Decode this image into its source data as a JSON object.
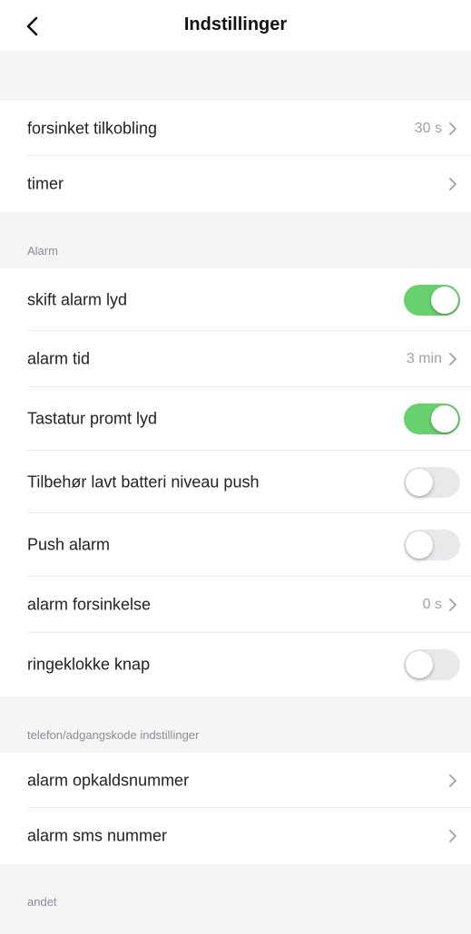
{
  "header": {
    "title": "Indstillinger",
    "back_icon": "chevron-left-icon"
  },
  "colors": {
    "toggle_on": "#67d16d",
    "toggle_off": "#e9e9eb",
    "section_bg": "#f5f5f5",
    "muted_text": "#a0a0a5"
  },
  "general": {
    "delay": {
      "label": "forsinket tilkobling",
      "value": "30 s"
    },
    "timer": {
      "label": "timer"
    }
  },
  "alarm": {
    "caption": "Alarm",
    "change_sound": {
      "label": "skift alarm lyd",
      "enabled": true
    },
    "alarm_time": {
      "label": "alarm tid",
      "value": "3 min"
    },
    "keypad_sound": {
      "label": "Tastatur promt lyd",
      "enabled": true
    },
    "low_battery_push": {
      "label": "Tilbehør lavt batteri niveau push",
      "enabled": false
    },
    "push_alarm": {
      "label": "Push alarm",
      "enabled": false
    },
    "alarm_delay": {
      "label": "alarm forsinkelse",
      "value": "0 s"
    },
    "doorbell_button": {
      "label": "ringeklokke knap",
      "enabled": false
    }
  },
  "phone": {
    "caption": "telefon/adgangskode indstillinger",
    "call_number": {
      "label": "alarm opkaldsnummer"
    },
    "sms_number": {
      "label": "alarm sms nummer"
    }
  },
  "other": {
    "caption": "andet"
  }
}
